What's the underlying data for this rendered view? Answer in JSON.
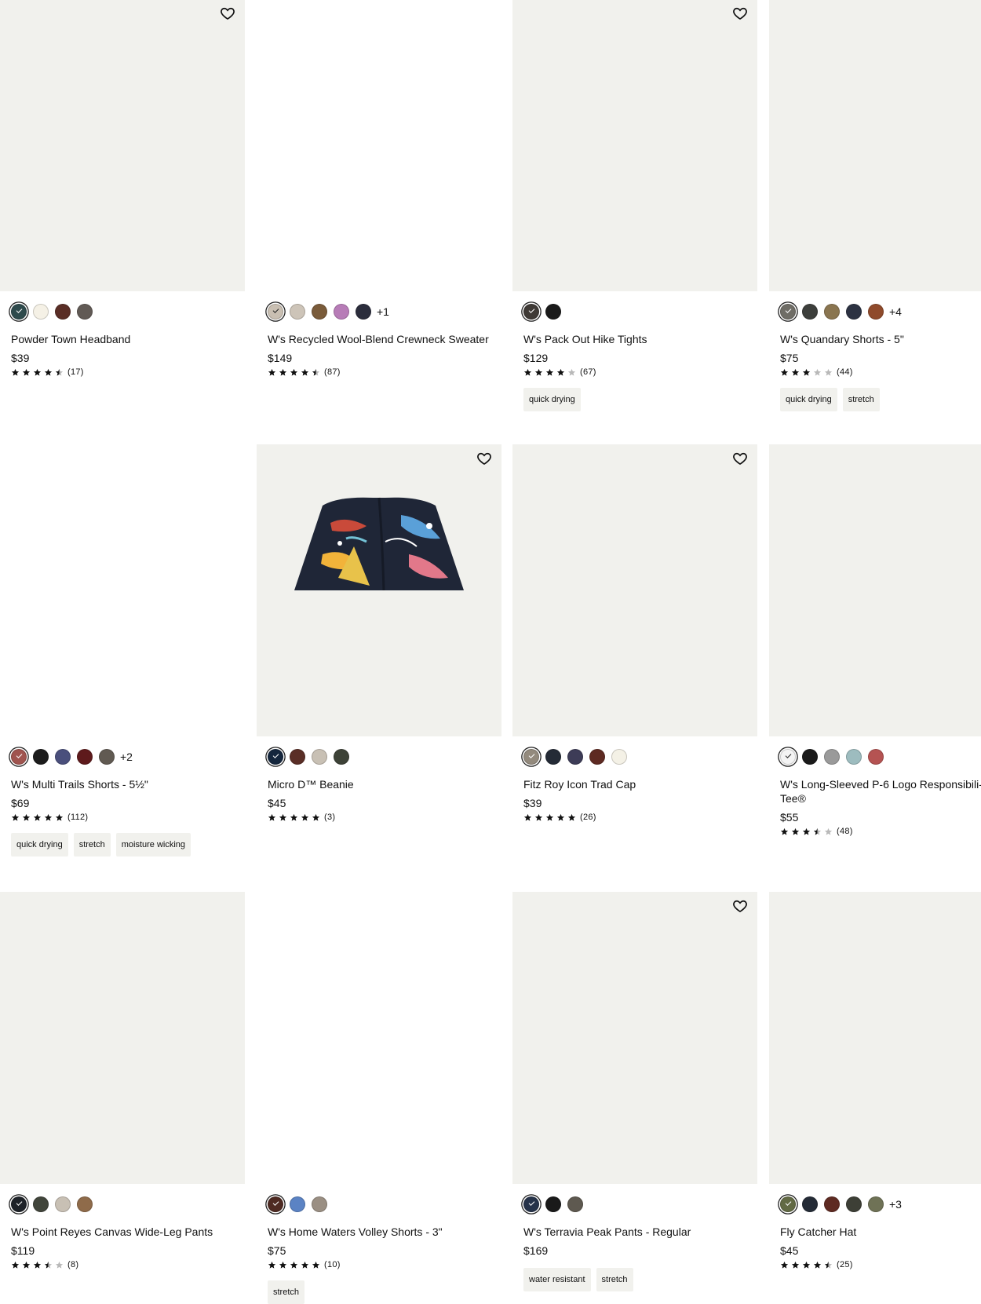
{
  "colors": {
    "card_bg": "#f1f1ed",
    "tag_bg": "#f1f1ed",
    "text": "#111111"
  },
  "products": [
    {
      "name": "Powder Town Headband",
      "price": "$39",
      "rating": 4.5,
      "reviews": "(17)",
      "favorite": true,
      "image_bg": "#f1f1ed",
      "swatches": [
        "#2e4a4c",
        "#f5f1e6",
        "#5a2e26",
        "#615a55"
      ],
      "more": "",
      "tags": []
    },
    {
      "name": "W's Recycled Wool-Blend Crewneck Sweater",
      "price": "$149",
      "rating": 4.5,
      "reviews": "(87)",
      "favorite": false,
      "image_bg": "#ffffff",
      "swatches": [
        "#c9bfb2",
        "#cdc4b8",
        "#7a5b3a",
        "#b77cb7",
        "#2b2d3c"
      ],
      "more": "+1",
      "tags": []
    },
    {
      "name": "W's Pack Out Hike Tights",
      "price": "$129",
      "rating": 4,
      "reviews": "(67)",
      "favorite": true,
      "image_bg": "#f1f1ed",
      "swatches": [
        "#3f3a36",
        "#1a1a1a"
      ],
      "more": "",
      "tags": [
        "quick drying"
      ]
    },
    {
      "name": "W's Quandary Shorts - 5\"",
      "price": "$75",
      "rating": 3,
      "reviews": "(44)",
      "favorite": false,
      "image_bg": "#f1f1ed",
      "swatches": [
        "#6f6d66",
        "#3d3f3c",
        "#8a7550",
        "#2c3242",
        "#8f4a2b"
      ],
      "more": "+4",
      "tags": [
        "quick drying",
        "stretch"
      ]
    },
    {
      "name": "W's Multi Trails Shorts - 5½\"",
      "price": "$69",
      "rating": 5,
      "reviews": "(112)",
      "favorite": false,
      "image_bg": "#ffffff",
      "swatches": [
        "#a0544f",
        "#1c1c1c",
        "#4a4f7c",
        "#5e1a1c",
        "#615a52"
      ],
      "more": "+2",
      "tags": [
        "quick drying",
        "stretch",
        "moisture wicking"
      ]
    },
    {
      "name": "Micro D™ Beanie",
      "price": "$45",
      "rating": 5,
      "reviews": "(3)",
      "favorite": true,
      "image_bg": "#f1f1ed",
      "swatches": [
        "#14263d",
        "#5a2e26",
        "#c8c0b4",
        "#3d4237"
      ],
      "more": "",
      "tags": []
    },
    {
      "name": "Fitz Roy Icon Trad Cap",
      "price": "$39",
      "rating": 5,
      "reviews": "(26)",
      "favorite": true,
      "image_bg": "#f1f1ed",
      "swatches": [
        "#938a7d",
        "#242b36",
        "#3d3c57",
        "#5e2a22",
        "#f4f1e6"
      ],
      "more": "",
      "tags": []
    },
    {
      "name": "W's Long-Sleeved P-6 Logo Responsibili-Tee®",
      "price": "$55",
      "rating": 3.5,
      "reviews": "(48)",
      "favorite": false,
      "image_bg": "#f1f1ed",
      "swatches": [
        "#f4f4f4",
        "#1a1a1a",
        "#9a9a9a",
        "#9dbcbf",
        "#b55352"
      ],
      "more": "",
      "tags": []
    },
    {
      "name": "W's Point Reyes Canvas Wide-Leg Pants",
      "price": "$119",
      "rating": 3.5,
      "reviews": "(8)",
      "favorite": false,
      "image_bg": "#f1f1ed",
      "swatches": [
        "#1e2228",
        "#41453b",
        "#c8c0b4",
        "#8f6b4a"
      ],
      "more": "",
      "tags": []
    },
    {
      "name": "W's Home Waters Volley Shorts - 3\"",
      "price": "$75",
      "rating": 5,
      "reviews": "(10)",
      "favorite": false,
      "image_bg": "#ffffff",
      "swatches": [
        "#4e2a22",
        "#5b83c4",
        "#9a8f83"
      ],
      "more": "",
      "tags": [
        "stretch"
      ]
    },
    {
      "name": "W's Terravia Peak Pants - Regular",
      "price": "$169",
      "rating": 0,
      "reviews": "",
      "favorite": true,
      "image_bg": "#f1f1ed",
      "swatches": [
        "#26334a",
        "#1a1a1a",
        "#5e5950"
      ],
      "more": "",
      "tags": [
        "water resistant",
        "stretch"
      ]
    },
    {
      "name": "Fly Catcher Hat",
      "price": "$45",
      "rating": 4.5,
      "reviews": "(25)",
      "favorite": false,
      "image_bg": "#f1f1ed",
      "swatches": [
        "#626a44",
        "#242b36",
        "#5e2a22",
        "#3d3f36",
        "#6f7256"
      ],
      "more": "+3",
      "tags": []
    }
  ]
}
